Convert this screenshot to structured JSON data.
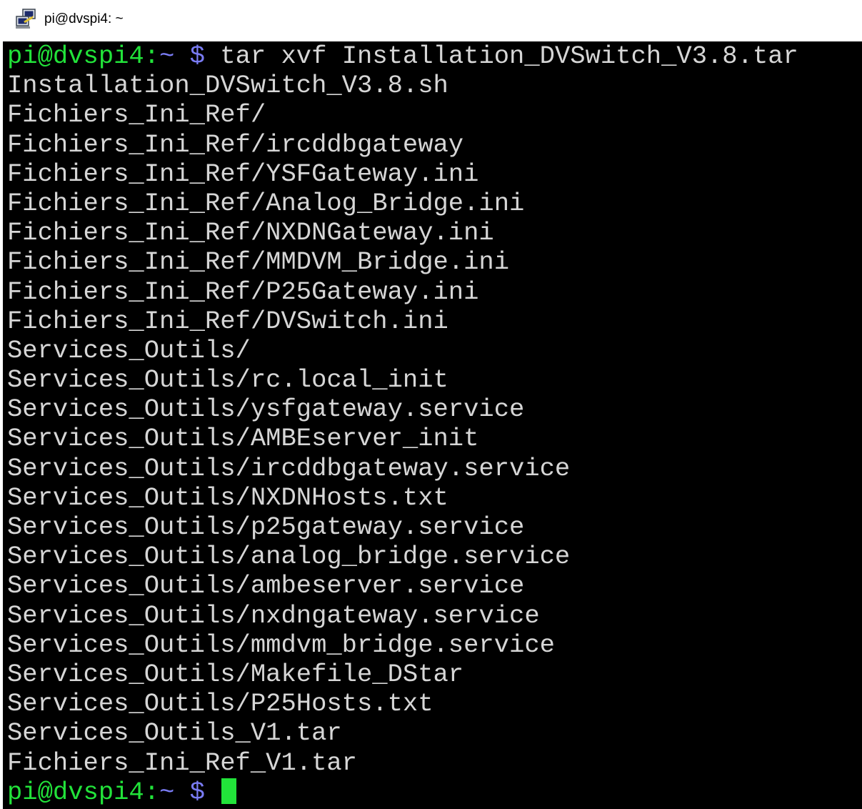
{
  "window": {
    "title": "pi@dvspi4: ~",
    "icon": "putty-terminal-icon"
  },
  "colors": {
    "background": "#000000",
    "text": "#d6d6d6",
    "prompt_user": "#22e33a",
    "prompt_path": "#7a7cf5",
    "cursor": "#22e33a"
  },
  "terminal": {
    "command_prompt": {
      "user_host": "pi@dvspi4",
      "colon": ":",
      "path": "~",
      "dollar": " $ ",
      "command": "tar xvf Installation_DVSwitch_V3.8.tar"
    },
    "output_lines": [
      "Installation_DVSwitch_V3.8.sh",
      "Fichiers_Ini_Ref/",
      "Fichiers_Ini_Ref/ircddbgateway",
      "Fichiers_Ini_Ref/YSFGateway.ini",
      "Fichiers_Ini_Ref/Analog_Bridge.ini",
      "Fichiers_Ini_Ref/NXDNGateway.ini",
      "Fichiers_Ini_Ref/MMDVM_Bridge.ini",
      "Fichiers_Ini_Ref/P25Gateway.ini",
      "Fichiers_Ini_Ref/DVSwitch.ini",
      "Services_Outils/",
      "Services_Outils/rc.local_init",
      "Services_Outils/ysfgateway.service",
      "Services_Outils/AMBEserver_init",
      "Services_Outils/ircddbgateway.service",
      "Services_Outils/NXDNHosts.txt",
      "Services_Outils/p25gateway.service",
      "Services_Outils/analog_bridge.service",
      "Services_Outils/ambeserver.service",
      "Services_Outils/nxdngateway.service",
      "Services_Outils/mmdvm_bridge.service",
      "Services_Outils/Makefile_DStar",
      "Services_Outils/P25Hosts.txt",
      "Services_Outils_V1.tar",
      "Fichiers_Ini_Ref_V1.tar"
    ],
    "final_prompt": {
      "user_host": "pi@dvspi4",
      "colon": ":",
      "path": "~",
      "dollar": " $ "
    }
  }
}
